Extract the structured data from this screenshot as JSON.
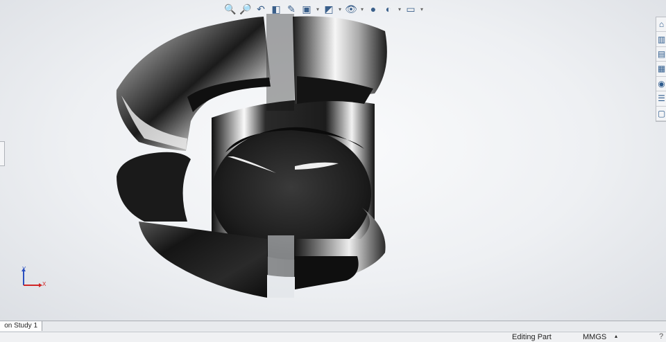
{
  "view_toolbar": {
    "buttons": [
      {
        "name": "zoom-to-fit-icon",
        "glyph": "🔍"
      },
      {
        "name": "zoom-to-area-icon",
        "glyph": "🔎"
      },
      {
        "name": "previous-view-icon",
        "glyph": "↶"
      },
      {
        "name": "section-view-icon",
        "glyph": "◧"
      },
      {
        "name": "dynamic-annotation-icon",
        "glyph": "✎"
      },
      {
        "name": "view-orientation-icon",
        "glyph": "▣"
      },
      {
        "name": "display-style-icon",
        "glyph": "◩"
      },
      {
        "name": "hide-show-items-icon",
        "glyph": "👁"
      },
      {
        "name": "edit-appearance-icon",
        "glyph": "●"
      },
      {
        "name": "apply-scene-icon",
        "glyph": "◐"
      },
      {
        "name": "view-settings-icon",
        "glyph": "▭"
      }
    ]
  },
  "task_pane": {
    "tabs": [
      {
        "name": "home-tab-icon",
        "glyph": "⌂"
      },
      {
        "name": "design-library-icon",
        "glyph": "▥"
      },
      {
        "name": "file-explorer-icon",
        "glyph": "▤"
      },
      {
        "name": "view-palette-icon",
        "glyph": "▦"
      },
      {
        "name": "appearances-icon",
        "glyph": "◉"
      },
      {
        "name": "custom-properties-icon",
        "glyph": "☰"
      },
      {
        "name": "forum-icon",
        "glyph": "▢"
      }
    ]
  },
  "triad": {
    "y_label": "Y",
    "x_label": "X"
  },
  "bottom_tabs": {
    "study_tab": "on Study 1"
  },
  "status_bar": {
    "editing": "Editing Part",
    "units": "MMGS",
    "units_arrow": "▴",
    "help_glyph": "?"
  },
  "colors": {
    "viewport_center": "#fafbfc",
    "viewport_edge": "#dcdfe4",
    "model_dark": "#151515",
    "model_highlight": "#f2f2f2"
  }
}
